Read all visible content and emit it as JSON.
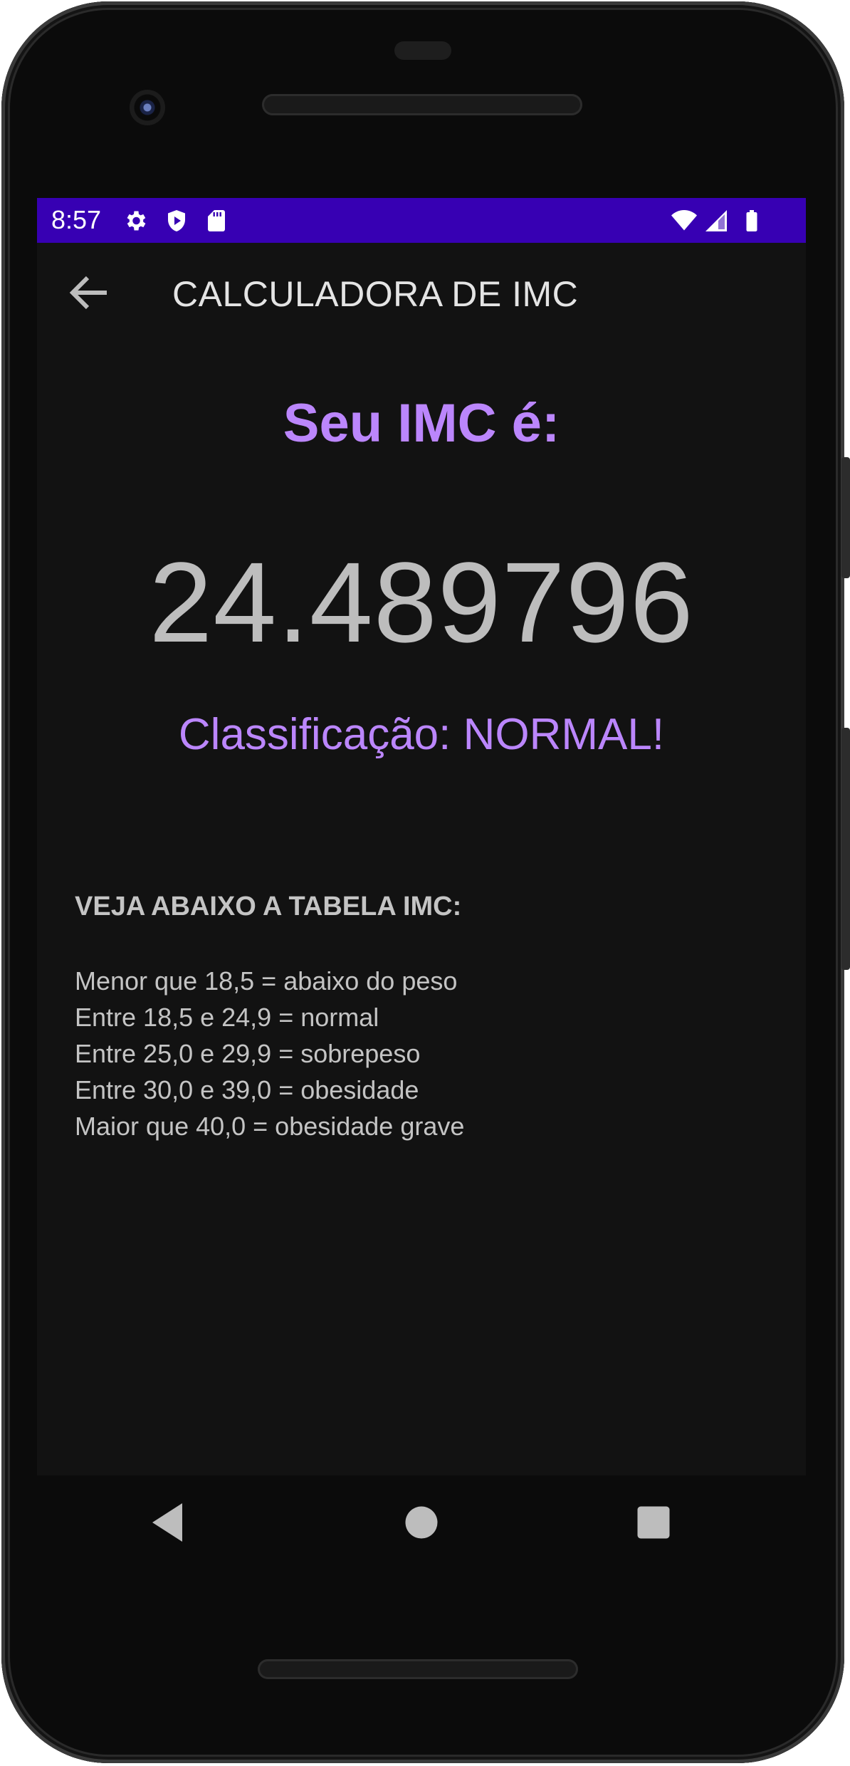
{
  "status_bar": {
    "time": "8:57",
    "left_icons": [
      "gear-icon",
      "shield-play-icon",
      "sd-card-icon"
    ],
    "right_icons": [
      "wifi-icon",
      "signal-icon",
      "battery-icon"
    ],
    "color": "#3700b3"
  },
  "app_bar": {
    "title": "CALCULADORA DE IMC",
    "back_icon": "arrow-back-icon"
  },
  "result": {
    "label": "Seu IMC é:",
    "value": "24.489796",
    "classification": "Classificação: NORMAL!"
  },
  "table": {
    "heading": "VEJA ABAIXO A TABELA IMC:",
    "rows": [
      "Menor que 18,5 = abaixo do peso",
      "Entre 18,5 e 24,9 = normal",
      "Entre 25,0 e 29,9 = sobrepeso",
      "Entre 30,0 e 39,0 = obesidade",
      "Maior que 40,0 = obesidade grave"
    ]
  },
  "nav_bar": {
    "icons": [
      "back-triangle-icon",
      "home-circle-icon",
      "recents-square-icon"
    ]
  },
  "colors": {
    "accent": "#bb86fc",
    "background": "#121212",
    "value_text": "#bdbdbd"
  }
}
